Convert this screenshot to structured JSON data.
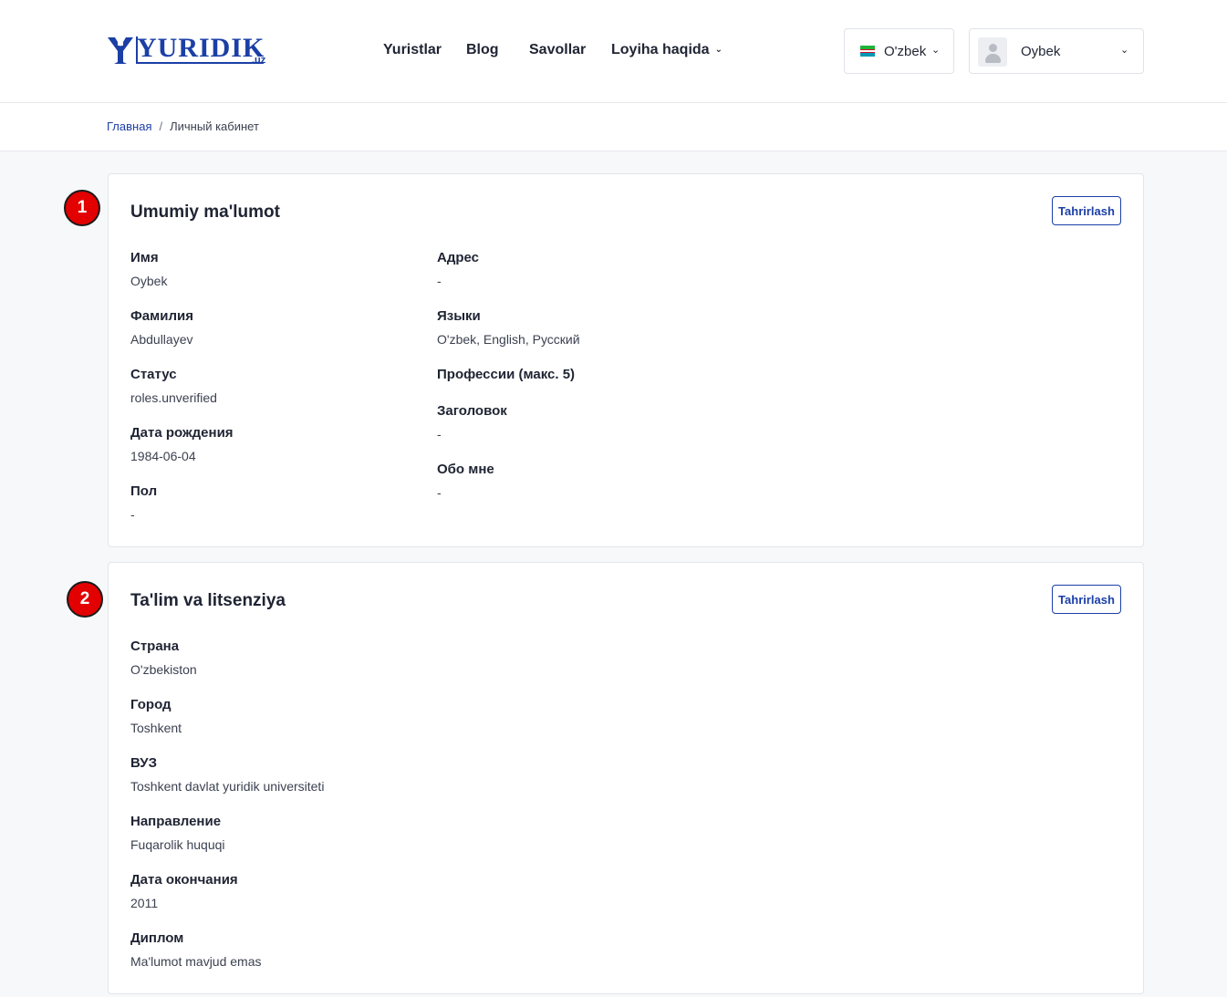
{
  "header": {
    "logo_text": "YURIDIK",
    "logo_suffix": ".uz",
    "nav": [
      {
        "label": "Yuristlar"
      },
      {
        "label": "Blog"
      },
      {
        "label": "Savollar"
      },
      {
        "label": "Loyiha haqida"
      }
    ],
    "language": "O'zbek",
    "user_name": "Oybek"
  },
  "breadcrumb": {
    "home": "Главная",
    "separator": "/",
    "current": "Личный кабинет"
  },
  "sections": [
    {
      "badge": "1",
      "title": "Umumiy ma'lumot",
      "edit_label": "Tahrirlash",
      "left_fields": [
        {
          "label": "Имя",
          "value": "Oybek"
        },
        {
          "label": "Фамилия",
          "value": "Abdullayev"
        },
        {
          "label": "Статус",
          "value": "roles.unverified"
        },
        {
          "label": "Дата рождения",
          "value": "1984-06-04"
        },
        {
          "label": "Пол",
          "value": "-"
        }
      ],
      "right_fields": [
        {
          "label": "Адрес",
          "value": "-"
        },
        {
          "label": "Языки",
          "value": "O'zbek, English, Русский"
        },
        {
          "label": "Профессии (макс. 5)",
          "value": ""
        },
        {
          "label": "Заголовок",
          "value": "-"
        },
        {
          "label": "Обо мне",
          "value": "-"
        }
      ]
    },
    {
      "badge": "2",
      "title": "Ta'lim va litsenziya",
      "edit_label": "Tahrirlash",
      "fields": [
        {
          "label": "Страна",
          "value": "O'zbekiston"
        },
        {
          "label": "Город",
          "value": "Toshkent"
        },
        {
          "label": "ВУЗ",
          "value": "Toshkent davlat yuridik universiteti"
        },
        {
          "label": "Направление",
          "value": "Fuqarolik huquqi"
        },
        {
          "label": "Дата окончания",
          "value": "2011"
        },
        {
          "label": "Диплом",
          "value": "Ma'lumot mavjud emas"
        }
      ]
    }
  ],
  "colors": {
    "brand": "#1b3fa6",
    "badge": "#e30000",
    "background": "#f7f8fa"
  }
}
